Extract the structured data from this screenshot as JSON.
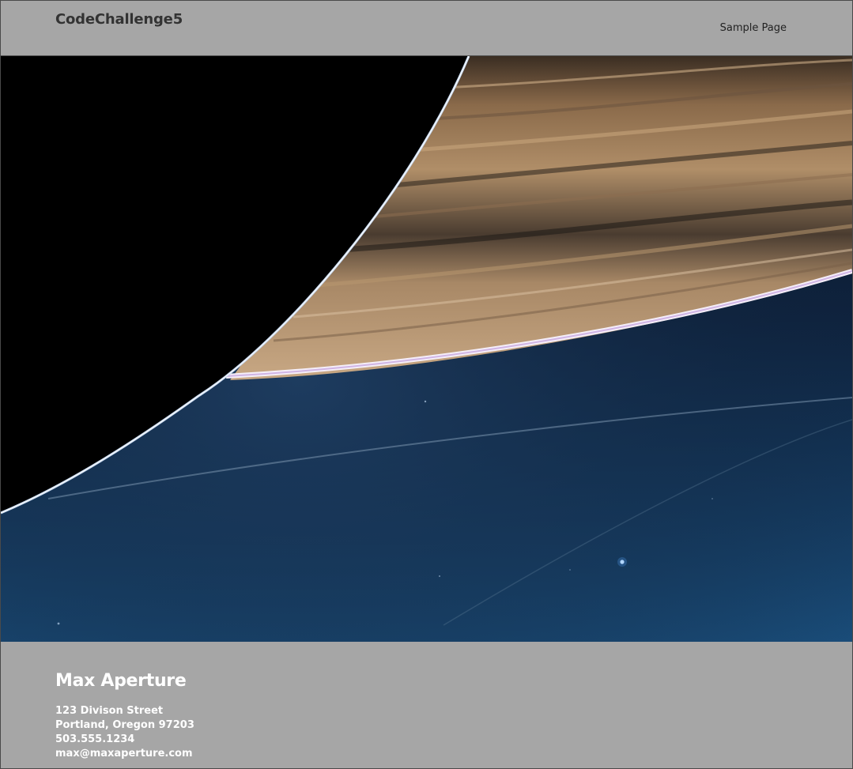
{
  "header": {
    "site_title": "CodeChallenge5",
    "nav": [
      {
        "label": "Sample Page"
      }
    ]
  },
  "footer": {
    "name": "Max Aperture",
    "street": "123 Divison Street",
    "city": "Portland, Oregon 97203",
    "phone": "503.555.1234",
    "email": "max@maxaperture.com"
  },
  "colors": {
    "chrome_gray": "#a6a6a6",
    "title_text": "#333333",
    "footer_text": "#ffffff"
  },
  "icons": {
    "hero": "saturn-rings-photo"
  }
}
